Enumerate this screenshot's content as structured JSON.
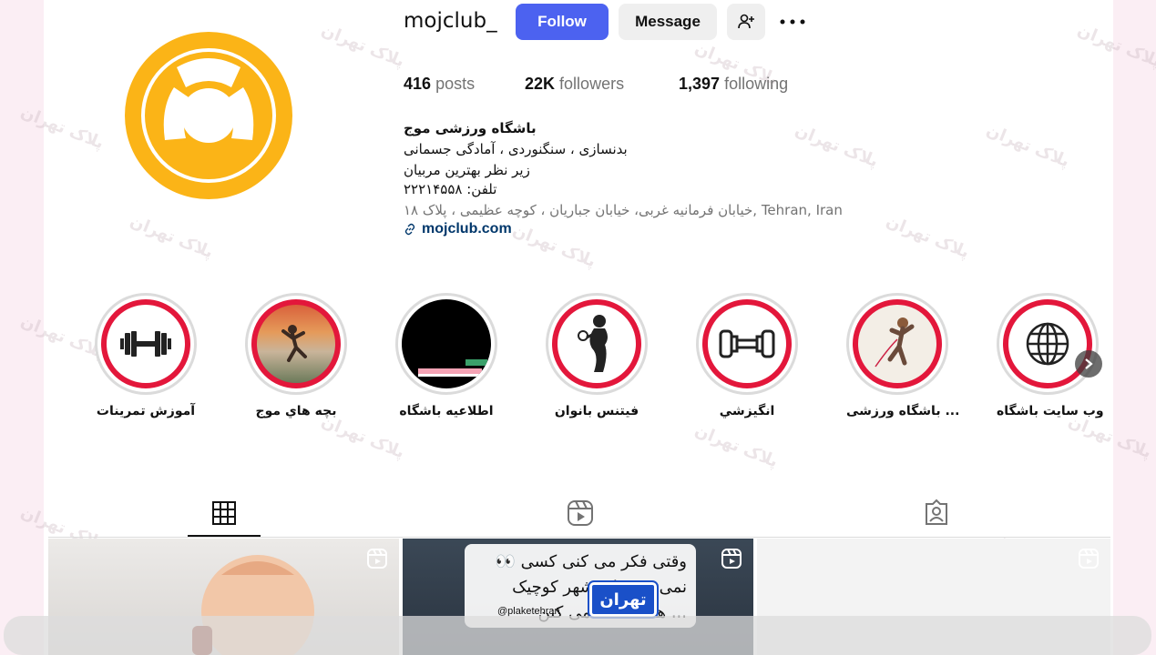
{
  "profile": {
    "username": "mojclub_",
    "follow_label": "Follow",
    "message_label": "Message"
  },
  "stats": {
    "posts_count": "416",
    "posts_label": "posts",
    "followers_count": "22K",
    "followers_label": "followers",
    "following_count": "1,397",
    "following_label": "following"
  },
  "bio": {
    "name": "باشگاه ورزشی موج",
    "line1": "بدنسازی ، سنگنوردی ، آمادگی جسمانی",
    "line2": "زیر نظر بهترین مربیان",
    "line3": "تلفن: ۲۲۲۱۴۵۵۸",
    "address": "خیابان فرمانیه غربی، خیابان جباریان ، کوچه عظیمی ، پلاک ۱۸, Tehran, Iran",
    "link": "mojclub.com"
  },
  "highlights": [
    {
      "label": "آموزش تمرينات",
      "icon": "dumbbell-icon"
    },
    {
      "label": "بچه هاي موج",
      "icon": "climber-image"
    },
    {
      "label": "اطلاعيه باشگاه",
      "icon": "announcement-image"
    },
    {
      "label": "فيتنس بانوان",
      "icon": "woman-fitness-icon"
    },
    {
      "label": "انگيزشي",
      "icon": "dumbbell-icon"
    },
    {
      "label": "باشگاه ورزشی ...",
      "icon": "climber-image"
    },
    {
      "label": "وب سايت باشگاه",
      "icon": "globe-icon"
    }
  ],
  "posts": {
    "post2_line1": "👀 وقتی فکر می کنی کسی",
    "post2_line2": "نمی بینه ولی شهر کوچیک",
    "post2_line3": "همه تماشا می کنن ...",
    "plate_text": "تهران",
    "watermark_brand": "پلاک تهران",
    "watermark_handle": "@plaketehran"
  },
  "colors": {
    "accent": "#4c62f0",
    "avatar_yellow": "#fbb417",
    "highlight_red": "#e3173b"
  }
}
